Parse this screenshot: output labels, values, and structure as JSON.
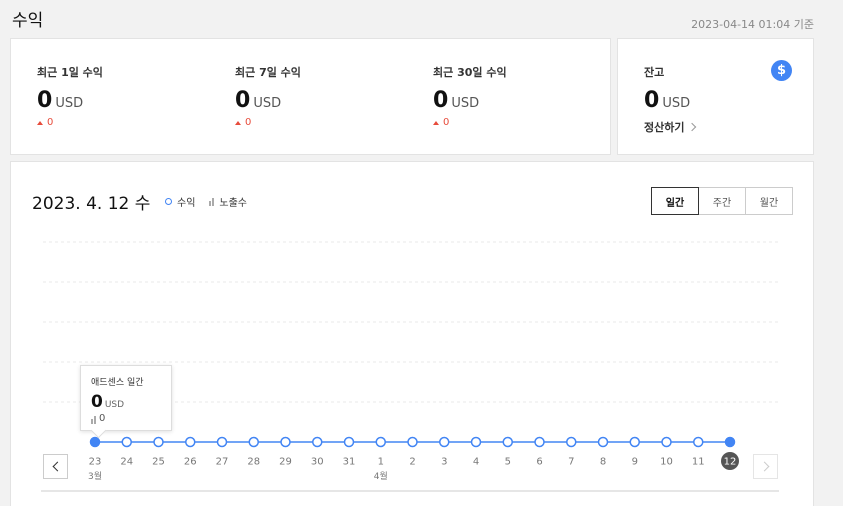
{
  "page": {
    "title": "수익",
    "timestamp": "2023-04-14 01:04 기준"
  },
  "summary": {
    "stats": [
      {
        "label": "최근 1일 수익",
        "value": "0",
        "unit": "USD",
        "delta": "0"
      },
      {
        "label": "최근 7일 수익",
        "value": "0",
        "unit": "USD",
        "delta": "0"
      },
      {
        "label": "최근 30일 수익",
        "value": "0",
        "unit": "USD",
        "delta": "0"
      }
    ]
  },
  "balance": {
    "label": "잔고",
    "value": "0",
    "unit": "USD",
    "link": "정산하기",
    "badge": "$"
  },
  "chart": {
    "date": "2023. 4. 12 수",
    "legend": {
      "revenue": "수익",
      "impressions": "노출수"
    },
    "tabs": [
      {
        "label": "일간",
        "active": true
      },
      {
        "label": "주간",
        "active": false
      },
      {
        "label": "월간",
        "active": false
      }
    ],
    "tooltip": {
      "title": "애드센스 일간",
      "value": "0",
      "unit": "USD",
      "impressions": "0"
    },
    "colors": {
      "line": "#4285f4",
      "selected": "#555555"
    }
  },
  "chart_data": {
    "type": "line",
    "categories": [
      "23",
      "24",
      "25",
      "26",
      "27",
      "28",
      "29",
      "30",
      "31",
      "1",
      "2",
      "3",
      "4",
      "5",
      "6",
      "7",
      "8",
      "9",
      "10",
      "11",
      "12"
    ],
    "month_labels": [
      {
        "index": 0,
        "label": "3월"
      },
      {
        "index": 9,
        "label": "4월"
      }
    ],
    "series": [
      {
        "name": "수익",
        "values": [
          0,
          0,
          0,
          0,
          0,
          0,
          0,
          0,
          0,
          0,
          0,
          0,
          0,
          0,
          0,
          0,
          0,
          0,
          0,
          0,
          0
        ]
      }
    ],
    "selected_index": 20,
    "highlight_index": 0,
    "grid": true
  }
}
